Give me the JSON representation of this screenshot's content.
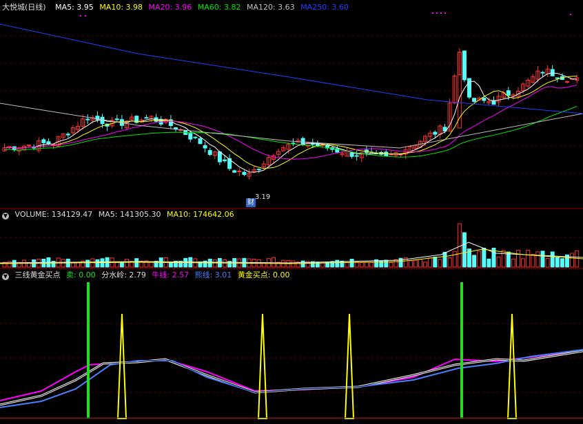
{
  "colors": {
    "up": "#ff3232",
    "down": "#54fcfc",
    "ma5": "#ffffff",
    "ma10": "#ffff00",
    "ma20": "#ff00ff",
    "ma60": "#00e600",
    "ma120": "#c0c0c0",
    "ma250": "#2040ff",
    "sell": "#22dd22",
    "fenshuiling": "#ffffff",
    "niu": "#ff00ff",
    "xiong": "#4a7fff",
    "gold": "#ffff00"
  },
  "price_panel": {
    "stock_name": "大悦城(日线)",
    "ma_labels": [
      {
        "key": "ma5",
        "text": "MA5: 3.95"
      },
      {
        "key": "ma10",
        "text": "MA10: 3.98"
      },
      {
        "key": "ma20",
        "text": "MA20: 3.96"
      },
      {
        "key": "ma60",
        "text": "MA60: 3.82"
      },
      {
        "key": "ma120",
        "text": "MA120: 3.63"
      },
      {
        "key": "ma250",
        "text": "MA250: 3.60"
      }
    ],
    "low_label": "3.19",
    "event_badge": "财"
  },
  "volume_panel": {
    "labels": [
      {
        "key": "vol",
        "text": "VOLUME: 134129.47"
      },
      {
        "key": "ma5",
        "text": "MA5: 141305.30"
      },
      {
        "key": "ma10",
        "text": "MA10: 174642.06"
      }
    ]
  },
  "indicator_panel": {
    "title": "三线黄金买点",
    "labels": [
      {
        "key": "sell",
        "text": "卖: 0.00"
      },
      {
        "key": "fenshuiling",
        "text": "分水岭: 2.79"
      },
      {
        "key": "niu",
        "text": "牛线: 2.57"
      },
      {
        "key": "xiong",
        "text": "熊线: 3.01"
      },
      {
        "key": "gold",
        "text": "黄金买点: 0.00"
      }
    ]
  },
  "chart_data": [
    {
      "type": "candlestick",
      "series": [
        {
          "name": "MA250",
          "y_start": 4.55,
          "y_end": 4.02
        },
        {
          "name": "MA120",
          "y_start": 4.2,
          "y_end": 3.62
        }
      ],
      "min_low": 3.19,
      "max_high": 4.54
    },
    {
      "type": "bar",
      "title": "VOLUME",
      "last_value": 134129.47
    },
    {
      "type": "line",
      "title": "三线黄金买点",
      "series": [
        {
          "name": "卖",
          "spikes_at_fraction": [
            0.15,
            0.79
          ]
        },
        {
          "name": "黄金买点",
          "spikes_at_fraction": [
            0.21,
            0.45,
            0.6,
            0.88
          ]
        }
      ]
    }
  ]
}
